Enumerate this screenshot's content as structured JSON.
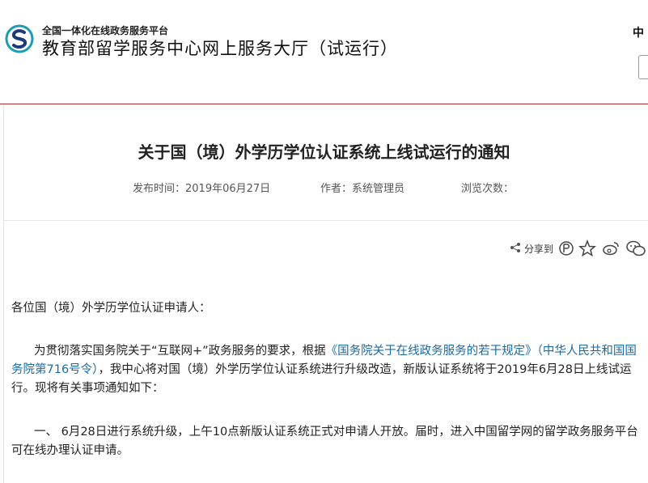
{
  "header": {
    "platform_label": "全国一体化在线政务服务平台",
    "site_title": "教育部留学服务中心网上服务大厅（试运行）",
    "lang_label": "中"
  },
  "colors": {
    "accent_red": "#b53034",
    "link_blue": "#1a6aa7",
    "logo_teal": "#1a9cb6",
    "logo_navy": "#1b3a7a"
  },
  "article": {
    "title": "关于国（境）外学历学位认证系统上线试运行的通知",
    "publish_time": "发布时间：2019年06月27日",
    "author": "作者：系统管理员",
    "views": "浏览次数：",
    "share_label": "分享到",
    "share_icons": [
      "share-icon",
      "qzone-icon",
      "favorite-star-icon",
      "weibo-icon",
      "wechat-icon"
    ],
    "greeting": "各位国（境）外学历学位认证申请人：",
    "p1_before": "为贯彻落实国务院关于“互联网+”政务服务的要求，根据",
    "p1_link": "《国务院关于在线政务服务的若干规定》（中华人民共和国国务院第716号令）",
    "p1_after": "，我中心将对国（境）外学历学位认证系统进行升级改造，新版认证系统将于2019年6月28日上线试运行。现将有关事项通知如下：",
    "p2": "一、 6月28日进行系统升级，上午10点新版认证系统正式对申请人开放。届时，进入中国留学网的留学政务服务平台可在线办理认证申请。"
  }
}
